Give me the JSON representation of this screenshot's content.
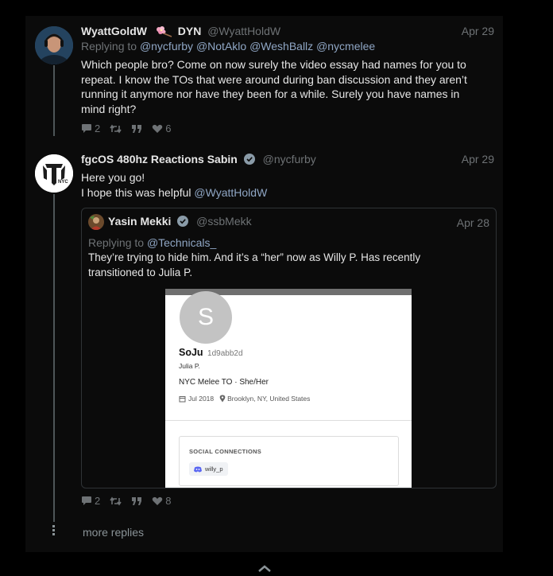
{
  "tweets": [
    {
      "name": "WyattGoldW",
      "name_suffix": "DYN",
      "handle": "@WyattHoldW",
      "date": "Apr 29",
      "replying_label": "Replying to",
      "replying_to": [
        "@nycfurby",
        "@NotAklo",
        "@WeshBallz",
        "@nycmelee"
      ],
      "text_lines": [
        "Which people bro? Come on now surely the video essay had names for you to",
        "repeat. I know the TOs that were around during ban discussion and they aren’t",
        "running it anymore nor have they been for a while. Surely you have names in",
        "mind right?"
      ],
      "stats": {
        "replies": "2",
        "likes": "6"
      }
    },
    {
      "name": "fgcOS 480hz Reactions Sabin",
      "handle": "@nycfurby",
      "date": "Apr 29",
      "text_line1": "Here you go!",
      "text_line2": "I hope this was helpful",
      "text_mention": "@WyattHoldW",
      "stats": {
        "replies": "2",
        "likes": "8"
      }
    }
  ],
  "quote": {
    "name": "Yasin Mekki",
    "handle": "@ssbMekk",
    "date": "Apr 28",
    "replying_label": "Replying to",
    "replying_to": "@Technicals_",
    "text_lines": [
      "They’re trying to hide him. And it’s a “her” now as Willy P. Has recently",
      "transitioned to Julia P."
    ],
    "screenshot": {
      "avatar_letter": "S",
      "display_name": "SoJu",
      "id": "1d9abb2d",
      "real_name": "Julia P.",
      "bio": "NYC Melee TO · She/Her",
      "joined": "Jul 2018",
      "location": "Brooklyn, NY, United States",
      "section_title": "SOCIAL CONNECTIONS",
      "connection": "willy_p"
    }
  },
  "more_replies": "more replies",
  "icons": {
    "reply": "reply-icon",
    "retweet": "retweet-icon",
    "quote": "quote-icon",
    "like": "heart-icon",
    "verified": "verified-badge-icon",
    "flower": "cherry-blossom-icon",
    "expand": "chevron-up-icon"
  },
  "colors": {
    "accent": "#8fa6c4",
    "muted": "#6e7275",
    "verified": "#8a9ba8"
  }
}
